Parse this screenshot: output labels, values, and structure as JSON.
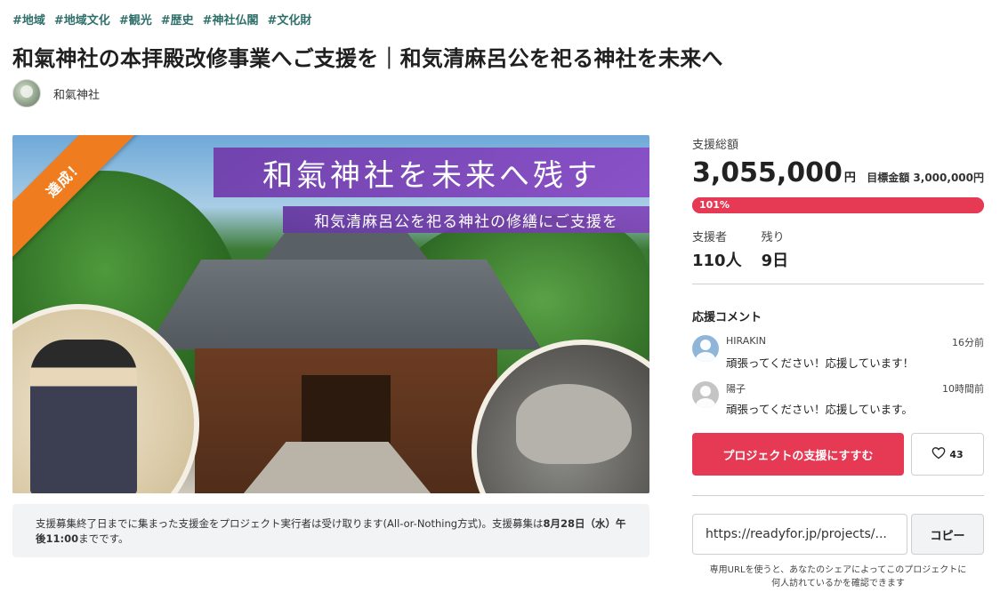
{
  "tags": [
    "#地域",
    "#地域文化",
    "#観光",
    "#歴史",
    "#神社仏閣",
    "#文化財"
  ],
  "title": "和氣神社の本拝殿改修事業へご支援を｜和気清麻呂公を祀る神社を未来へ",
  "owner": {
    "name": "和氣神社"
  },
  "hero": {
    "ribbon": "達成！",
    "banner_main": "和氣神社を未来へ残す",
    "banner_sub": "和気清麻呂公を祀る神社の修繕にご支援を"
  },
  "notice": {
    "text": "支援募集終了日までに集まった支援金をプロジェクト実行者は受け取ります(All-or-Nothing方式)。支援募集は",
    "deadline": "8月28日（水）午後11:00",
    "suffix": "までです。"
  },
  "funding": {
    "total_label": "支援総額",
    "total_amount": "3,055,000",
    "currency": "円",
    "goal_text": "目標金額 3,000,000円",
    "progress_percent": 101,
    "progress_label": "101%",
    "supporters_label": "支援者",
    "supporters_value": "110人",
    "remaining_label": "残り",
    "remaining_value": "9日"
  },
  "comments": {
    "title": "応援コメント",
    "items": [
      {
        "author": "HIRAKIN",
        "time": "16分前",
        "text": "頑張ってください！応援しています！",
        "avatar_color": "#8fb6d9"
      },
      {
        "author": "陽子",
        "time": "10時間前",
        "text": "頑張ってください！応援しています。",
        "avatar_color": "#c4c4c4"
      }
    ]
  },
  "actions": {
    "support_label": "プロジェクトの支援にすすむ",
    "favorite_count": "43",
    "favorite_icon": "heart-icon"
  },
  "share": {
    "url": "https://readyfor.jp/projects/...",
    "copy_label": "コピー",
    "note": "専用URLを使うと、あなたのシェアによってこのプロジェクトに何人訪れているかを確認できます"
  },
  "colors": {
    "accent": "#e63a54",
    "tag": "#2f6f6a",
    "ribbon": "#ef7d1f",
    "banner": "#7a40b8"
  }
}
